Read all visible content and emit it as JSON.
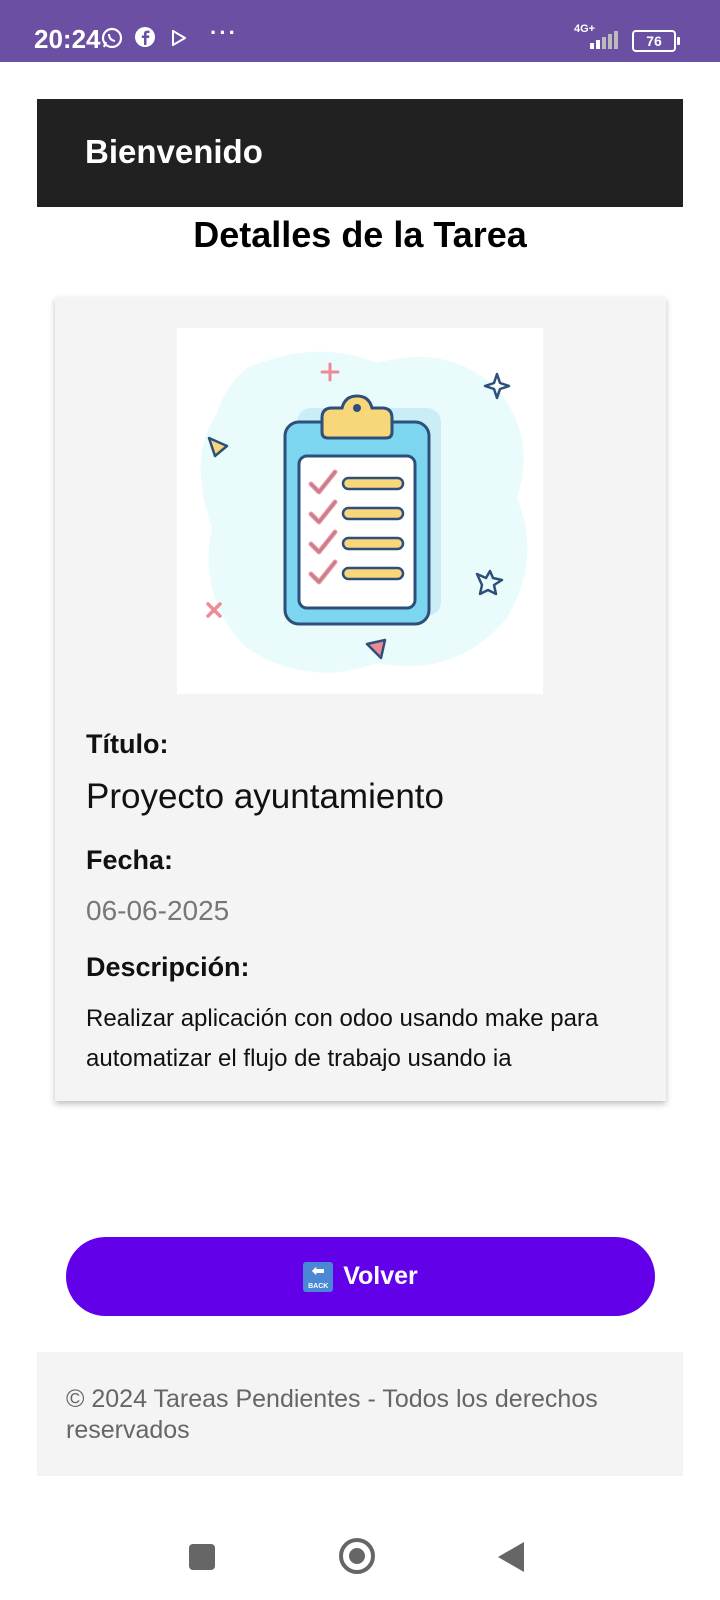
{
  "status_bar": {
    "time": "20:24",
    "network": "4G+",
    "battery": "76"
  },
  "header": {
    "title": "Bienvenido"
  },
  "page": {
    "title": "Detalles de la Tarea"
  },
  "task": {
    "title_label": "Título:",
    "title_value": "Proyecto ayuntamiento",
    "date_label": "Fecha:",
    "date_value": "06-06-2025",
    "description_label": "Descripción:",
    "description_value": "Realizar aplicación con odoo usando make para automatizar el flujo de trabajo usando ia"
  },
  "actions": {
    "back_label": "Volver",
    "back_icon_text": "BACK"
  },
  "footer": {
    "text": "© 2024 Tareas Pendientes - Todos los derechos reservados"
  },
  "colors": {
    "status_bar": "#6a4fa3",
    "header_bg": "#212121",
    "button_bg": "#6200ea",
    "card_bg": "#f4f4f4"
  }
}
